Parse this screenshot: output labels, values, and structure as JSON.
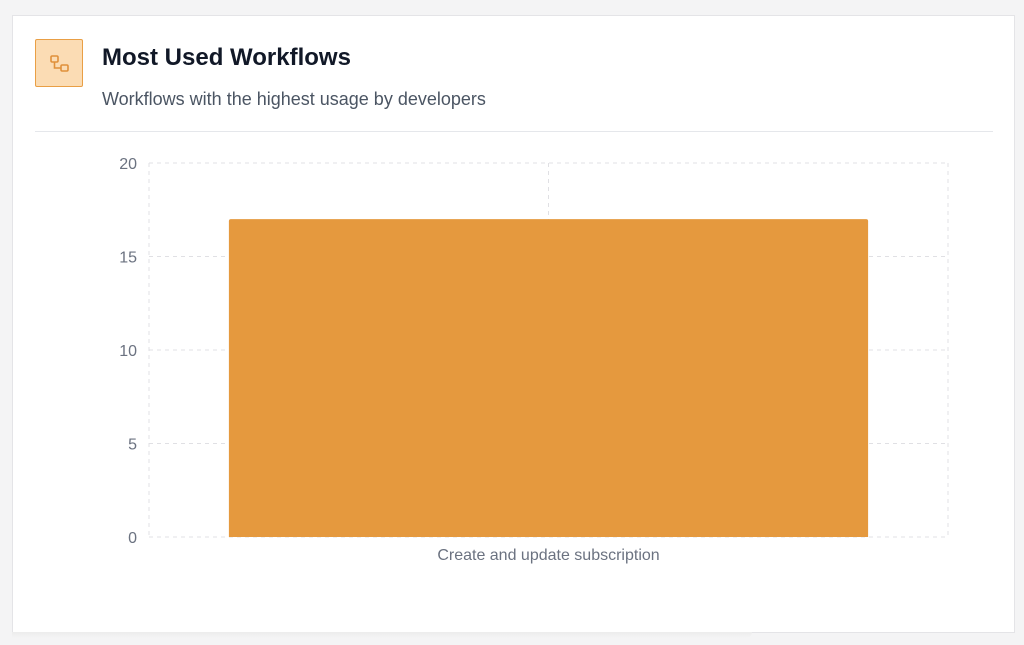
{
  "card": {
    "icon": "workflow-icon",
    "title": "Most Used Workflows",
    "subtitle": "Workflows with the highest usage by developers"
  },
  "colors": {
    "bar": "#e5993e",
    "icon_bg": "#fbdcb4",
    "icon_border": "#e99f45",
    "grid": "#e0e0e4",
    "axis_text": "#6b7280"
  },
  "chart_data": {
    "type": "bar",
    "categories": [
      "Create and update subscription"
    ],
    "values": [
      17
    ],
    "yticks": [
      0,
      5,
      10,
      15,
      20
    ],
    "ylim": [
      0,
      20
    ],
    "grid": true,
    "xlabel": "",
    "ylabel": ""
  }
}
